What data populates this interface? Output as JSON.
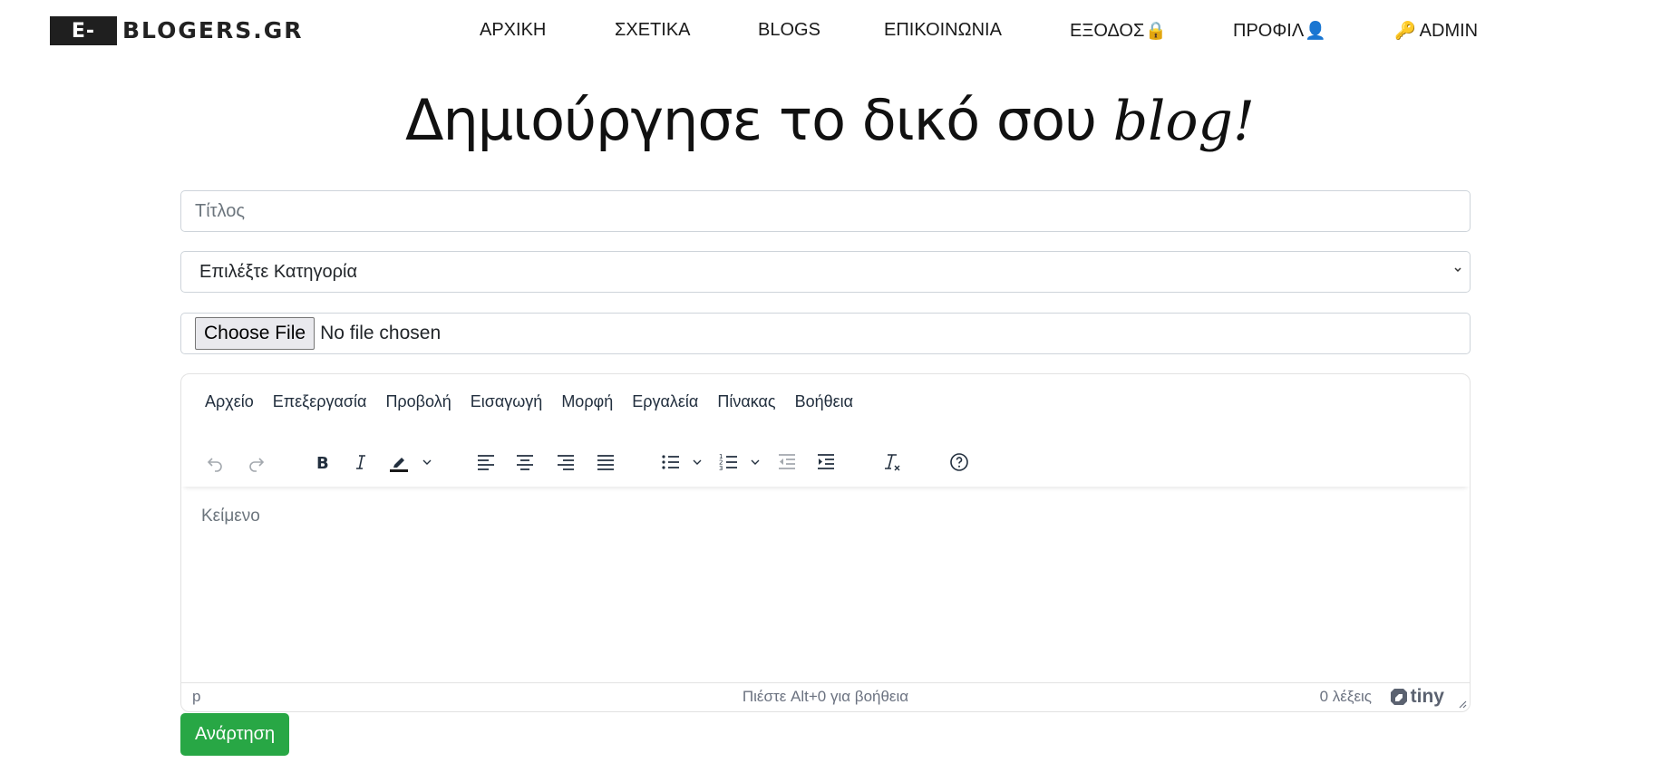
{
  "brand": {
    "logo_prefix": "E-",
    "logo_suffix": "BLOGERS.GR"
  },
  "nav": {
    "home": "ΑΡΧΙΚΗ",
    "about": "ΣΧΕΤΙΚΑ",
    "blogs": "BLOGS",
    "contact": "ΕΠΙΚΟΙΝΩΝΙΑ",
    "logout": "ΕΞΟΔΟΣ",
    "logout_emoji": "🔒",
    "profile": "ΠΡΟΦΙΛ",
    "profile_emoji": "👤",
    "admin": "ADMIN",
    "admin_emoji": "🔑"
  },
  "heading": {
    "main": "Δημιούργησε το δικό σου",
    "script": "blog!"
  },
  "form": {
    "title_placeholder": "Τίτλος",
    "category_selected": "Επιλέξτε Κατηγορία",
    "file_button": "Choose File",
    "file_status": "No file chosen",
    "submit_label": "Ανάρτηση"
  },
  "editor": {
    "menu": [
      "Αρχείο",
      "Επεξεργασία",
      "Προβολή",
      "Εισαγωγή",
      "Μορφή",
      "Εργαλεία",
      "Πίνακας",
      "Βοήθεια"
    ],
    "placeholder": "Κείμενο",
    "status_path": "p",
    "status_help": "Πιέστε Alt+0 για βοήθεια",
    "word_count": "0 λέξεις",
    "brand": "tiny"
  },
  "colors": {
    "submit": "#28a745",
    "logo_bg": "#1f1f1f",
    "highlight_bar": "#1a1a1a"
  }
}
